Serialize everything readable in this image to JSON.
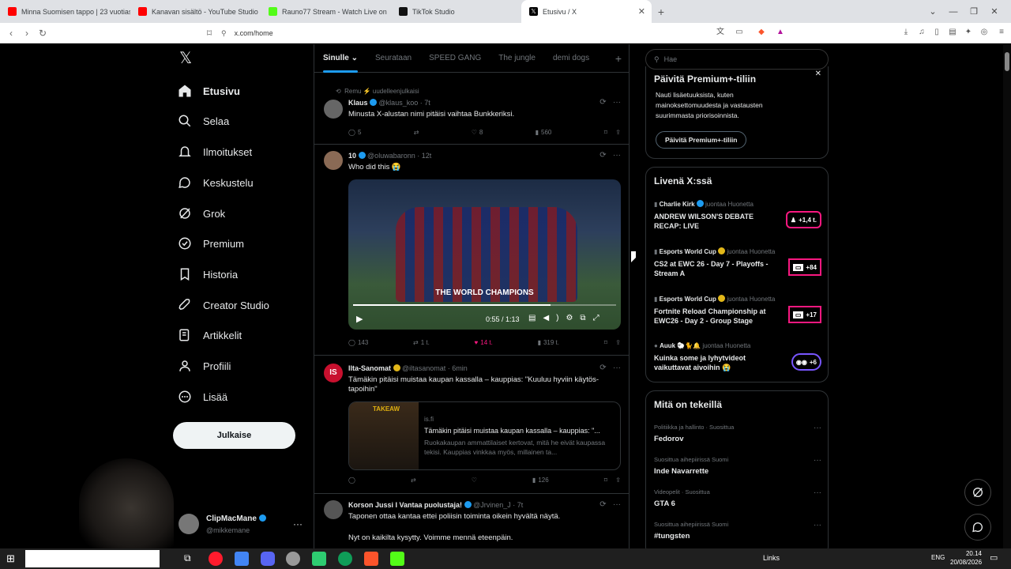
{
  "browser": {
    "tabs": [
      {
        "title": "Minna Suomisen tappo | 23 vuotias ...",
        "color": "#ff0000"
      },
      {
        "title": "Kanavan sisältö - YouTube Studio",
        "color": "#ff0000"
      },
      {
        "title": "Rauno77 Stream - Watch Live on",
        "color": "#53fc18"
      },
      {
        "title": "TikTok Studio",
        "color": "#111111"
      },
      {
        "title": "Etusivu / X",
        "color": "#000000",
        "active": true
      }
    ],
    "url": "x.com/home"
  },
  "sidebar": {
    "items": [
      {
        "label": "Etusivu",
        "icon": "home-icon",
        "bold": true
      },
      {
        "label": "Selaa",
        "icon": "search-icon"
      },
      {
        "label": "Ilmoitukset",
        "icon": "bell-icon"
      },
      {
        "label": "Keskustelu",
        "icon": "chat-icon"
      },
      {
        "label": "Grok",
        "icon": "grok-icon"
      },
      {
        "label": "Premium",
        "icon": "premium-icon"
      },
      {
        "label": "Historia",
        "icon": "bookmark-icon"
      },
      {
        "label": "Creator Studio",
        "icon": "rocket-icon"
      },
      {
        "label": "Artikkelit",
        "icon": "article-icon"
      },
      {
        "label": "Profiili",
        "icon": "person-icon"
      },
      {
        "label": "Lisää",
        "icon": "more-icon"
      }
    ],
    "post_button": "Julkaise",
    "account": {
      "name": "ClipMacMane",
      "handle": "@mikkemane"
    }
  },
  "feed": {
    "tabs": [
      "Sinulle",
      "Seurataan",
      "SPEED GANG",
      "The jungle",
      "demi dogs"
    ],
    "posts": [
      {
        "repost_note": "Remu ⚡ uudelleenjulkaisi",
        "name": "Klaus",
        "handle": "@klaus_koo",
        "time": "7t",
        "text": "Minusta X-alustan nimi pitäisi vaihtaa Bunkkeriksi.",
        "replies": "5",
        "reposts": "",
        "likes": "8",
        "views": "560"
      },
      {
        "name": "10",
        "handle": "@oluwabaronn",
        "time": "12t",
        "text": "Who did this 😭",
        "video": {
          "caption": "THE WORLD CHAMPIONS",
          "time": "0:55 / 1:13"
        },
        "replies": "143",
        "reposts": "1 t.",
        "likes": "14 t.",
        "views": "319 t."
      },
      {
        "name": "Ilta-Sanomat",
        "handle": "@iltasanomat",
        "time": "6min",
        "text": "Tämäkin pitäisi muistaa kaupan kassalla – kauppias: \"Kuuluu hyviin käytös-tapoihin\"",
        "card": {
          "domain": "is.fi",
          "title": "Tämäkin pitäisi muistaa kaupan kassalla – kauppias: \"...",
          "desc": "Ruokakaupan ammattilaiset kertovat, mitä he eivät kaupassa tekisi. Kauppias vinkkaa myös, millainen ta...",
          "thumb_text": "TAKEAW"
        },
        "replies": "",
        "reposts": "",
        "likes": "",
        "views": "126"
      },
      {
        "name": "Korson Jussi I Vantaa puolustaja!",
        "handle": "@Jrvinen_J",
        "time": "7t",
        "text": "Taponen ottaa kantaa ettei poliisin toiminta oikein hyvältä näytä.",
        "text2": "Nyt on kaikilta kysytty. Voimme mennä eteenpäin."
      }
    ]
  },
  "right": {
    "search_placeholder": "Hae",
    "premium": {
      "title": "Päivitä Premium+-tiliin",
      "body": "Nauti lisäetuuksista, kuten mainoksettomuudesta ja vastausten suurimmasta priorisoinnista.",
      "button": "Päivitä Premium+-tiliin"
    },
    "live": {
      "title": "Livenä X:ssä",
      "items": [
        {
          "host": "Charlie Kirk",
          "note": "juontaa Huonetta",
          "title": "ANDREW WILSON'S DEBATE RECAP: LIVE",
          "badge": "+1,4 t."
        },
        {
          "host": "Esports World Cup",
          "note": "juontaa Huonetta",
          "title": "CS2 at EWC 26 - Day 7 - Playoffs - Stream A",
          "badge": "+84"
        },
        {
          "host": "Esports World Cup",
          "note": "juontaa Huonetta",
          "title": "Fortnite Reload Championship at EWC26 - Day 2 - Group Stage",
          "badge": "+17"
        },
        {
          "host": "Auuk 🐑🐈🔔",
          "note": "juontaa Huonetta",
          "title": "Kuinka some ja lyhytvideot vaikuttavat aivoihin 😭",
          "badge": "+6"
        }
      ]
    },
    "trends": {
      "title": "Mitä on tekeillä",
      "items": [
        {
          "category": "Politiikka ja hallinto · Suosittua",
          "name": "Fedorov"
        },
        {
          "category": "Suosittua aihepiirissä Suomi",
          "name": "Inde Navarrette"
        },
        {
          "category": "Videopelit · Suosittua",
          "name": "GTA 6"
        },
        {
          "category": "Suosittua aihepiirissä Suomi",
          "name": "#tungsten"
        }
      ]
    }
  },
  "taskbar": {
    "links": "Links",
    "lang": "ENG",
    "time": "20.14",
    "date": "20/08/2026"
  }
}
